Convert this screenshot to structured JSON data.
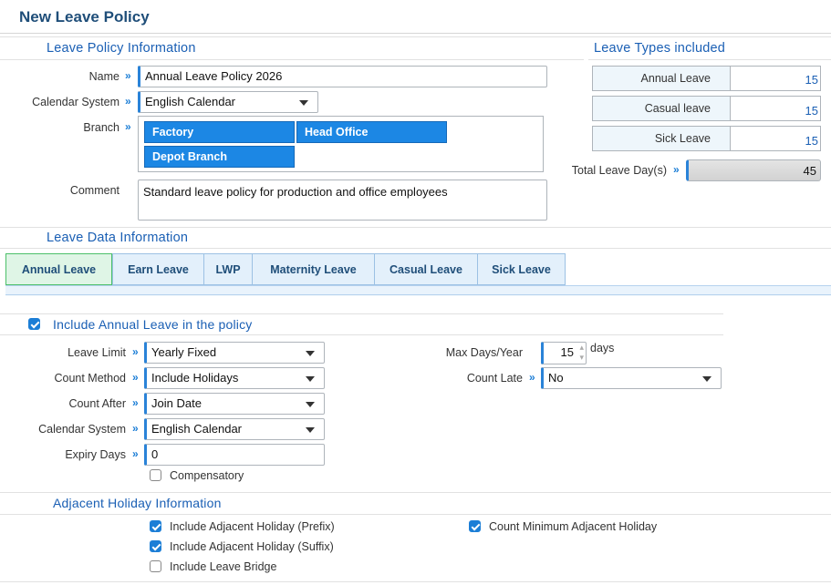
{
  "page": {
    "title": "New Leave Policy"
  },
  "policy": {
    "section_title": "Leave Policy Information",
    "name_label": "Name",
    "name_value": "Annual Leave Policy 2026",
    "calendar_label": "Calendar System",
    "calendar_value": "English Calendar",
    "branch_label": "Branch",
    "branches": [
      "Factory",
      "Head Office",
      "Depot Branch"
    ],
    "comment_label": "Comment",
    "comment_value": "Standard leave policy for production and office employees"
  },
  "leave_types": {
    "section_title": "Leave Types included",
    "rows": [
      {
        "name": "Annual Leave",
        "days": "15"
      },
      {
        "name": "Casual leave",
        "days": "15"
      },
      {
        "name": "Sick Leave",
        "days": "15"
      }
    ],
    "total_label": "Total Leave Day(s)",
    "total_value": "45"
  },
  "leave_data": {
    "section_title": "Leave Data Information",
    "tabs": [
      "Annual Leave",
      "Earn Leave",
      "LWP",
      "Maternity Leave",
      "Casual Leave",
      "Sick Leave"
    ],
    "active_tab": "Annual Leave"
  },
  "annual": {
    "include_label": "Include Annual Leave in the policy",
    "include_checked": true,
    "leave_limit_label": "Leave Limit",
    "leave_limit_value": "Yearly Fixed",
    "count_method_label": "Count Method",
    "count_method_value": "Include Holidays",
    "count_after_label": "Count After",
    "count_after_value": "Join Date",
    "calendar_label": "Calendar System",
    "calendar_value": "English Calendar",
    "expiry_label": "Expiry Days",
    "expiry_value": "0",
    "compensatory_label": "Compensatory",
    "compensatory_checked": false,
    "max_days_label": "Max Days/Year",
    "max_days_value": "15",
    "max_days_unit": "days",
    "count_late_label": "Count Late",
    "count_late_value": "No"
  },
  "adjacent": {
    "section_title": "Adjacent Holiday Information",
    "prefix_label": "Include Adjacent Holiday (Prefix)",
    "prefix_checked": true,
    "suffix_label": "Include Adjacent Holiday (Suffix)",
    "suffix_checked": true,
    "bridge_label": "Include Leave Bridge",
    "bridge_checked": false,
    "min_adjacent_label": "Count Minimum Adjacent Holiday",
    "min_adjacent_checked": true
  },
  "colors": {
    "accent": "#1c7ed6",
    "heading": "#1a5fb4",
    "active_tab": "#dff5e6"
  }
}
